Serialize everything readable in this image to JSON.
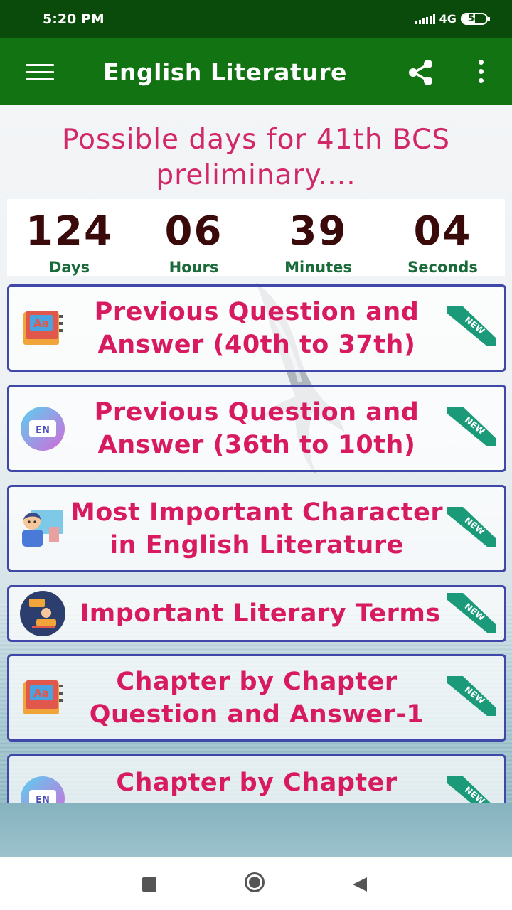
{
  "status_bar": {
    "time": "5:20 PM",
    "network": "4G",
    "battery": "54"
  },
  "app_bar": {
    "title": "English Literature",
    "menu_icon": "hamburger-menu-icon",
    "share_icon": "share-icon",
    "more_icon": "more-vert-icon"
  },
  "headline": {
    "line1": "Possible days for 41th BCS",
    "line2": "preliminary...."
  },
  "countdown": {
    "days": {
      "value": "124",
      "label": "Days"
    },
    "hours": {
      "value": "06",
      "label": "Hours"
    },
    "minutes": {
      "value": "39",
      "label": "Minutes"
    },
    "seconds": {
      "value": "04",
      "label": "Seconds"
    }
  },
  "cards": [
    {
      "line1": "Previous Question and",
      "line2": "Answer (40th to 37th)",
      "icon": "dictionary-book-icon",
      "badge": "NEW"
    },
    {
      "line1": "Previous Question and",
      "line2": "Answer (36th to 10th)",
      "icon": "en-language-icon",
      "badge": "NEW"
    },
    {
      "line1": "Most Important Character",
      "line2": "in English Literature",
      "icon": "teacher-board-icon",
      "badge": "NEW"
    },
    {
      "line1": "Important Literary Terms",
      "line2": "",
      "icon": "presenter-icon",
      "badge": "NEW"
    },
    {
      "line1": "Chapter by Chapter",
      "line2": "Question and Answer-1",
      "icon": "dictionary-book-icon",
      "badge": "NEW"
    },
    {
      "line1": "Chapter by Chapter",
      "line2": "",
      "icon": "en-language-icon",
      "badge": "NEW"
    }
  ],
  "nav_bar": {
    "recents": "recents-square-icon",
    "home": "home-circle-icon",
    "back": "back-triangle-icon"
  },
  "colors": {
    "status_bar": "#0a4a0a",
    "app_bar": "#127312",
    "headline": "#d2286a",
    "card_text": "#d81b60",
    "card_border": "#3f47a8",
    "count_number": "#3a0a0a",
    "count_label": "#1a6a3a",
    "ribbon": "#1b9a7a"
  }
}
